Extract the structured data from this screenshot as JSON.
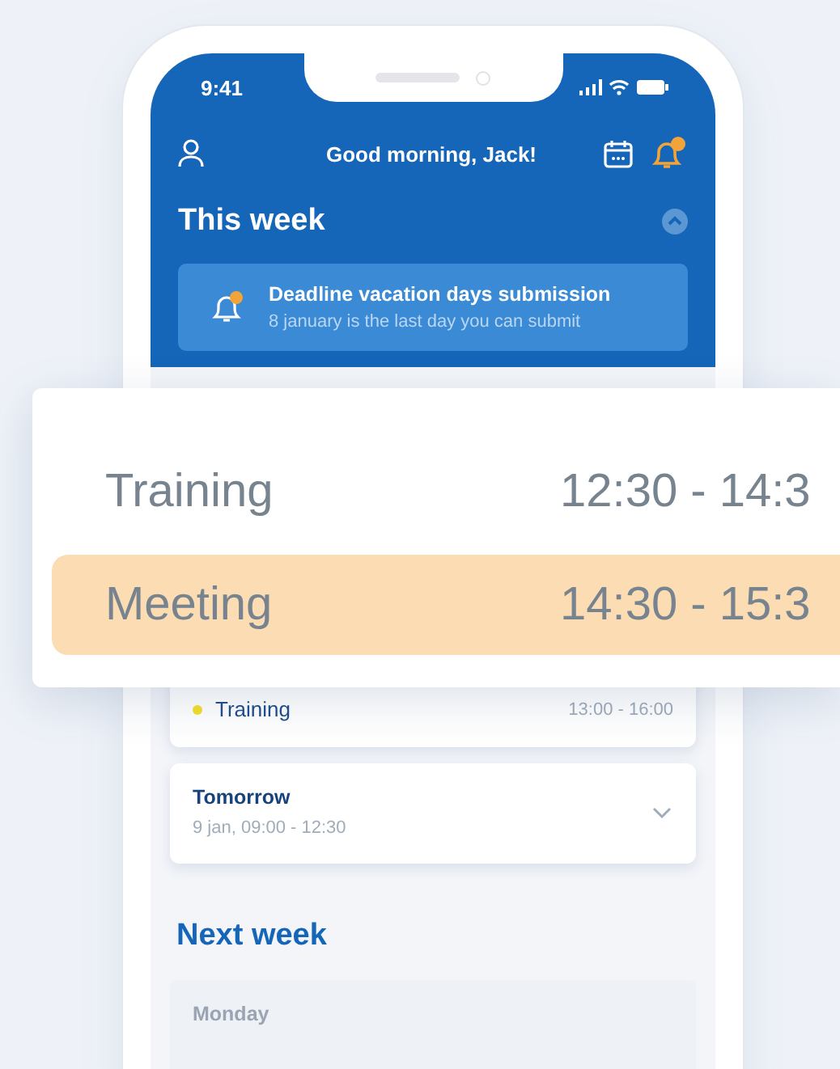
{
  "status_bar": {
    "time": "9:41"
  },
  "header": {
    "greeting": "Good morning, Jack!",
    "notification_badge": true
  },
  "this_week": {
    "title": "This week",
    "expanded": true
  },
  "notice": {
    "title": "Deadline vacation days submission",
    "text": "8 january is the last day you can submit"
  },
  "popup_rows": [
    {
      "name": "Training",
      "time": "12:30 - 14:3",
      "selected": false
    },
    {
      "name": "Meeting",
      "time": "14:30 - 15:3",
      "selected": true
    }
  ],
  "events": [
    {
      "name": "Training",
      "time": "13:00 - 16:00",
      "color": "#f5e02a"
    }
  ],
  "tomorrow": {
    "title": "Tomorrow",
    "detail": "9 jan, 09:00 - 12:30",
    "expanded": false
  },
  "next_week": {
    "title": "Next week"
  },
  "next_days": [
    {
      "title": "Monday"
    }
  ]
}
